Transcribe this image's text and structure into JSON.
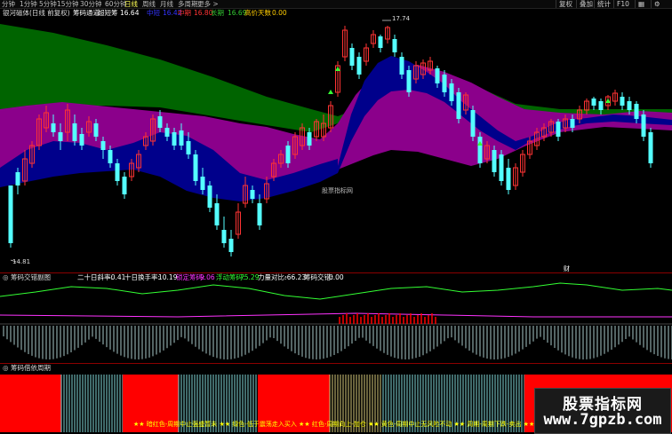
{
  "toolbar": {
    "periods": [
      "分钟",
      "1分钟",
      "5分钟",
      "15分钟",
      "30分钟",
      "60分钟",
      "日线",
      "周线",
      "月线",
      "多周期",
      "更多 >"
    ],
    "active_period": "日线",
    "right_buttons": [
      "复权",
      "叠加",
      "统计",
      "F10"
    ],
    "tool_icons": [
      "chart-style-icon",
      "settings-icon"
    ]
  },
  "main_legend": {
    "title": "筹码通道",
    "bracket": "超短筹",
    "bracket_val": "16.64",
    "items": [
      {
        "label": "中短",
        "value": "16.42",
        "color": "#3333ff"
      },
      {
        "label": "中期",
        "value": "16.80",
        "color": "#ff3333"
      },
      {
        "label": "长期",
        "value": "16.69",
        "color": "#00cc00"
      }
    ],
    "extra_label": "高价天数",
    "extra_value": "0.00",
    "instrument": "银河磁体(日线 前复权)"
  },
  "annotations": {
    "high_label": "17.74",
    "low_label": "14.81",
    "center_watermark": "股票指标网",
    "marker": "财"
  },
  "sub1": {
    "name": "筹码交错副图",
    "items": [
      {
        "label": "二十日斜率:",
        "value": "-0.41",
        "color": "#ffffff"
      },
      {
        "label": "十日换手率:",
        "value": "10.19",
        "color": "#ffffff"
      },
      {
        "label": "锁定筹码:",
        "value": "9.06",
        "color": "#ff33ff"
      },
      {
        "label": "浮动筹码:",
        "value": "75.29",
        "color": "#33ff33"
      },
      {
        "label": "力量对比:",
        "value": "-66.23",
        "color": "#ffffff"
      },
      {
        "label": "筹码交错:",
        "value": "0.00",
        "color": "#ffffff"
      }
    ]
  },
  "sub2": {
    "name": "筹码借依周期",
    "banner": "★★ 暗红色-周期中止强盛暂未 ★★ 绿色-低于震荡走入买入 ★★ 红色-周期向上-加仓 ★★ 黄色-周期中止无风险不动 ★★ 周期-周期下跌-卖出 ★★"
  },
  "watermark": {
    "line1": "股票指标网",
    "line2": "www.7gpzb.com"
  },
  "colors": {
    "up": "#ff3333",
    "down": "#54ffff",
    "band_green": "#006400",
    "band_purple": "#8b008b",
    "band_navy": "#00008b",
    "cyan_bar": "#7fd6d6",
    "red_bar": "#ff0000"
  }
}
